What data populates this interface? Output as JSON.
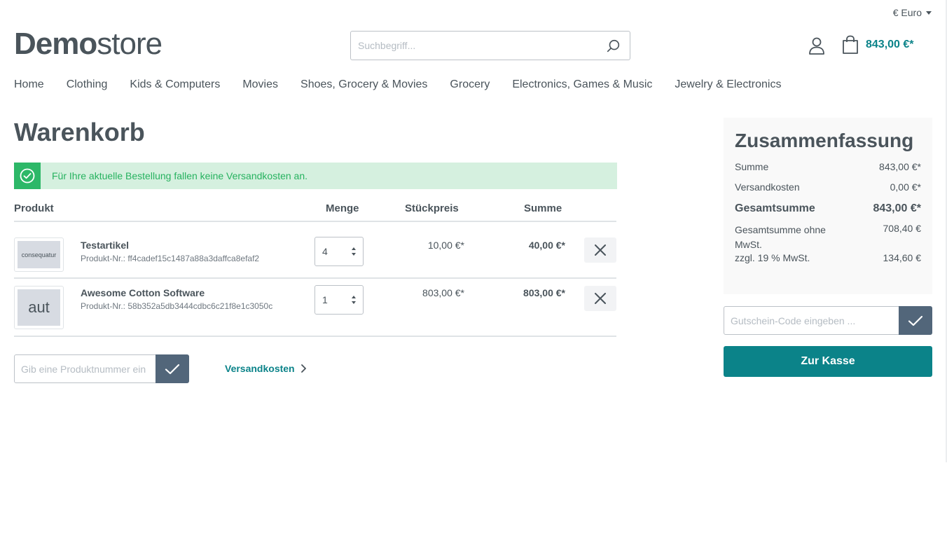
{
  "header": {
    "currency": "€ Euro",
    "logo_bold": "Demo",
    "logo_light": "store",
    "search_placeholder": "Suchbegriff...",
    "cart_total": "843,00 €*"
  },
  "nav": {
    "items": [
      "Home",
      "Clothing",
      "Kids & Computers",
      "Movies",
      "Shoes, Grocery & Movies",
      "Grocery",
      "Electronics, Games & Music",
      "Jewelry & Electronics"
    ]
  },
  "page": {
    "title": "Warenkorb",
    "alert": "Für Ihre aktuelle Bestellung fallen keine Versandkosten an."
  },
  "table": {
    "headers": {
      "product": "Produkt",
      "quantity": "Menge",
      "unit_price": "Stückpreis",
      "total": "Summe"
    },
    "rows": [
      {
        "thumb_text": "consequatur",
        "name": "Testartikel",
        "number": "Produkt-Nr.: ff4cadef15c1487a88a3daffca8efaf2",
        "quantity": "4",
        "unit_price": "10,00 €*",
        "total": "40,00 €*"
      },
      {
        "thumb_text": "aut",
        "name": "Awesome Cotton Software",
        "number": "Produkt-Nr.: 58b352a5db3444cdbc6c21f8e1c3050c",
        "quantity": "1",
        "unit_price": "803,00 €*",
        "total": "803,00 €*"
      }
    ]
  },
  "add_product": {
    "placeholder": "Gib eine Produktnummer ein",
    "shipping_link": "Versandkosten"
  },
  "summary": {
    "title": "Zusammenfassung",
    "subtotal_label": "Summe",
    "subtotal_value": "843,00 €*",
    "shipping_label": "Versandkosten",
    "shipping_value": "0,00 €*",
    "grand_label": "Gesamtsumme",
    "grand_value": "843,00 €*",
    "net_label": "Gesamtsumme ohne MwSt.",
    "net_value": "708,40 €",
    "tax_label": "zzgl. 19 % MwSt.",
    "tax_value": "134,60 €"
  },
  "coupon": {
    "placeholder": "Gutschein-Code eingeben ..."
  },
  "checkout": {
    "label": "Zur Kasse"
  },
  "colors": {
    "accent": "#0b8389",
    "success": "#2db868",
    "success_bg": "#d5f0df",
    "button_dark": "#52667a"
  }
}
